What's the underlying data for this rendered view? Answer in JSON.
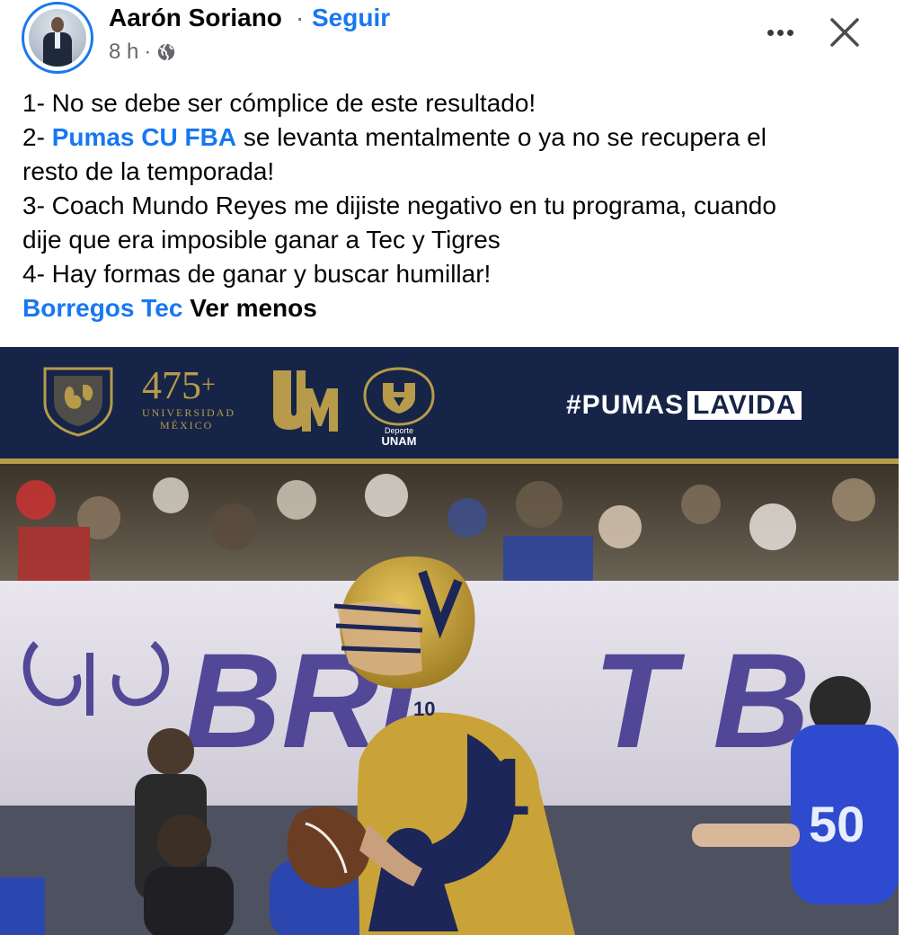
{
  "post": {
    "author": "Aarón Soriano",
    "separator": "·",
    "follow_label": "Seguir",
    "time": "8 h",
    "meta_separator": "·",
    "privacy_icon": "globe-icon"
  },
  "controls": {
    "more_icon": "more-options-icon",
    "close_icon": "close-icon"
  },
  "text": {
    "line1": "1- No se debe ser cómplice de este resultado!",
    "line2_prefix": "2- ",
    "line2_mention": "Pumas CU FBA",
    "line2_suffix": " se levanta mentalmente o ya no se recupera el",
    "line3": "resto de la temporada!",
    "line4": "3- Coach Mundo Reyes me dijiste negativo en tu programa, cuando",
    "line5": "dije que era imposible ganar a Tec y Tigres",
    "line6": "4- Hay formas de ganar y buscar humillar!",
    "line7_mention": "Borregos Tec",
    "line7_space": " ",
    "see_less": "Ver menos"
  },
  "photo": {
    "banner": {
      "number": "475",
      "plus": "+",
      "univ_line1": "UNIVERSIDAD",
      "univ_line2": "MÉXICO",
      "deporte": "Deporte",
      "unam": "UNAM",
      "hashtag_a": "#PUMAS",
      "hashtag_b": "LAVIDA"
    }
  },
  "colors": {
    "link": "#1877f2",
    "banner_navy": "#162447",
    "gold": "#b79a4a"
  }
}
